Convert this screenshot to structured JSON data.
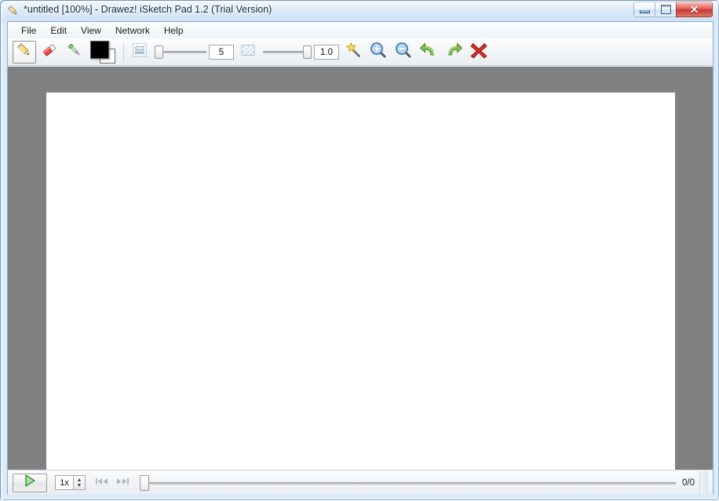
{
  "window": {
    "title": "*untitled [100%] - Drawez! iSketch Pad 1.2 (Trial Version)",
    "icon": "pencil-icon",
    "controls": {
      "minimize_label": "–",
      "maximize_label": "□",
      "close_label": "✕"
    },
    "accent_color": "#c4352c",
    "frame_color": "#6e94b8"
  },
  "menubar": {
    "items": [
      {
        "label": "File"
      },
      {
        "label": "Edit"
      },
      {
        "label": "View"
      },
      {
        "label": "Network"
      },
      {
        "label": "Help"
      }
    ]
  },
  "toolbar": {
    "tools": [
      {
        "name": "pencil-tool",
        "icon": "pencil-icon",
        "selected": true
      },
      {
        "name": "eraser-tool",
        "icon": "eraser-icon",
        "selected": false
      },
      {
        "name": "eyedropper-tool",
        "icon": "eyedropper-icon",
        "selected": false
      }
    ],
    "colors": {
      "foreground": "#000000",
      "background": "#ffffff"
    },
    "stroke_size_icon": "line-width-icon",
    "stroke_size_value": "5",
    "stroke_size_slider_percent": 0,
    "transparency_icon": "checker-transparency-icon",
    "opacity_value": "1.0",
    "opacity_slider_percent": 100,
    "actions": [
      {
        "name": "magic-wand-button",
        "icon": "magic-wand-icon"
      },
      {
        "name": "zoom-in-button",
        "icon": "zoom-in-icon"
      },
      {
        "name": "zoom-out-button",
        "icon": "zoom-out-icon"
      },
      {
        "name": "undo-button",
        "icon": "undo-icon"
      },
      {
        "name": "redo-button",
        "icon": "redo-icon"
      },
      {
        "name": "clear-button",
        "icon": "red-x-icon"
      }
    ]
  },
  "canvas": {
    "background_color": "#808080",
    "sheet_color": "#ffffff",
    "zoom_level": "100%"
  },
  "statusbar": {
    "play_label": "▶",
    "speed_value": "1x",
    "prev_frame_icon": "skip-previous-icon",
    "next_frame_icon": "skip-next-icon",
    "timeline_position_percent": 0,
    "frame_counter": "0/0"
  }
}
